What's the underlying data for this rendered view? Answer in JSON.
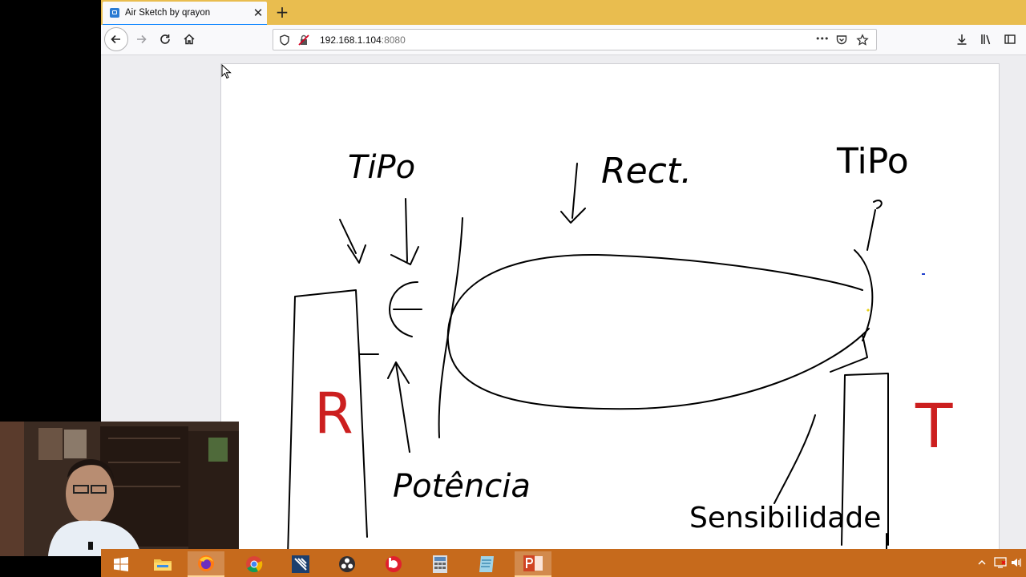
{
  "tab": {
    "title": "Air Sketch by qrayon",
    "close_symbol": "✕",
    "new_tab_symbol": "+"
  },
  "address": {
    "host": "192.168.1.104",
    "port": ":8080"
  },
  "toolbar": {
    "more_symbol": "•••"
  },
  "sketch": {
    "labels": {
      "tipo_left": "TiPo",
      "rect": "Rect.",
      "tipo_right": "TiPo",
      "r_mark": "R",
      "t_mark": "T",
      "potencia": "Potência",
      "sensibilidade": "Sensibilidade"
    },
    "colors": {
      "ink": "#000000",
      "red": "#cc1f1f",
      "yellow": "#e8d21a",
      "blue": "#1f3fcc"
    }
  },
  "taskbar": {
    "accent": "#c66a1c",
    "apps": [
      "windows-start-icon",
      "file-explorer-icon",
      "firefox-icon",
      "chrome-icon",
      "video-editor-icon",
      "obs-icon",
      "beats-icon",
      "calculator-icon",
      "notepad-icon",
      "powerpoint-icon"
    ]
  }
}
